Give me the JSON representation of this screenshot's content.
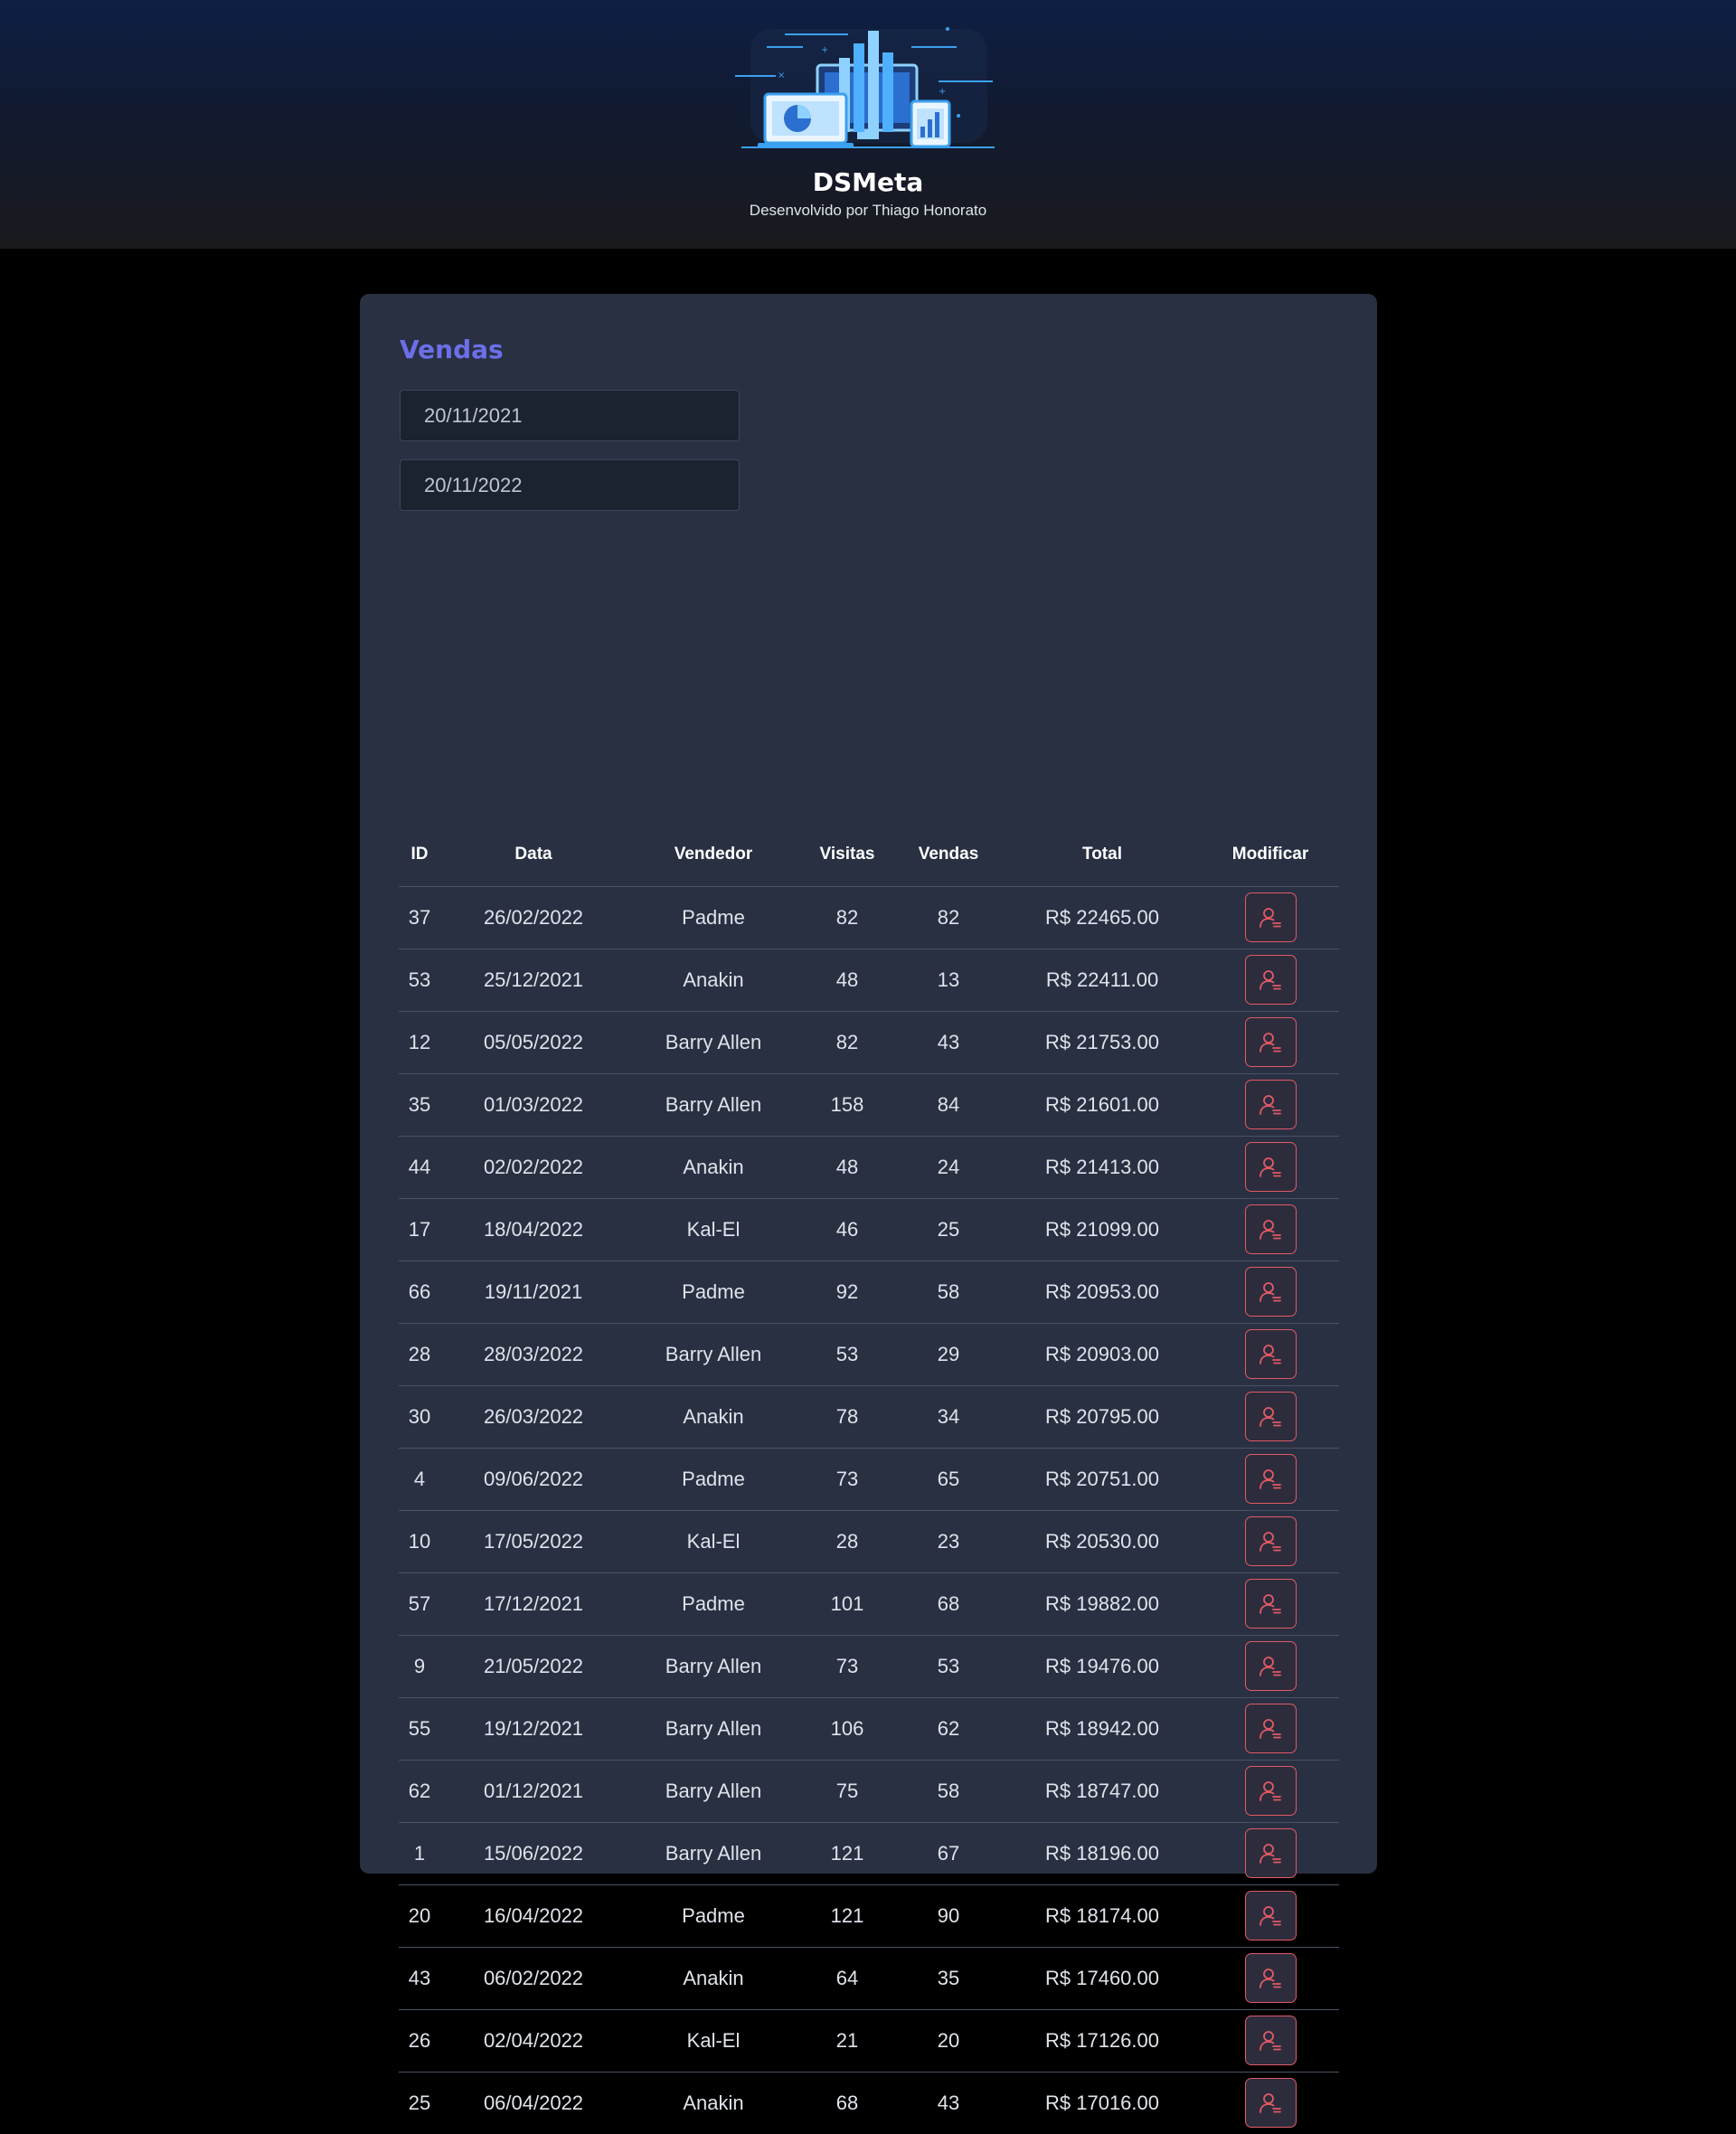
{
  "header": {
    "title": "DSMeta",
    "subtitle": "Desenvolvido por Thiago Honorato",
    "logo_icon": "dashboard-devices-illustration"
  },
  "colors": {
    "accent": "#6c6fe8",
    "card_bg": "#283042",
    "button_border": "#e15a66"
  },
  "sales": {
    "title": "Vendas",
    "min_date": "20/11/2021",
    "max_date": "20/11/2022",
    "columns": {
      "id": "ID",
      "date": "Data",
      "seller": "Vendedor",
      "visited": "Visitas",
      "deals": "Vendas",
      "amount": "Total",
      "modify": "Modificar"
    },
    "modify_icon": "user-notify-icon",
    "rows": [
      {
        "id": "37",
        "date": "26/02/2022",
        "seller": "Padme",
        "visited": "82",
        "deals": "82",
        "amount": "R$ 22465.00"
      },
      {
        "id": "53",
        "date": "25/12/2021",
        "seller": "Anakin",
        "visited": "48",
        "deals": "13",
        "amount": "R$ 22411.00"
      },
      {
        "id": "12",
        "date": "05/05/2022",
        "seller": "Barry Allen",
        "visited": "82",
        "deals": "43",
        "amount": "R$ 21753.00"
      },
      {
        "id": "35",
        "date": "01/03/2022",
        "seller": "Barry Allen",
        "visited": "158",
        "deals": "84",
        "amount": "R$ 21601.00"
      },
      {
        "id": "44",
        "date": "02/02/2022",
        "seller": "Anakin",
        "visited": "48",
        "deals": "24",
        "amount": "R$ 21413.00"
      },
      {
        "id": "17",
        "date": "18/04/2022",
        "seller": "Kal-El",
        "visited": "46",
        "deals": "25",
        "amount": "R$ 21099.00"
      },
      {
        "id": "66",
        "date": "19/11/2021",
        "seller": "Padme",
        "visited": "92",
        "deals": "58",
        "amount": "R$ 20953.00"
      },
      {
        "id": "28",
        "date": "28/03/2022",
        "seller": "Barry Allen",
        "visited": "53",
        "deals": "29",
        "amount": "R$ 20903.00"
      },
      {
        "id": "30",
        "date": "26/03/2022",
        "seller": "Anakin",
        "visited": "78",
        "deals": "34",
        "amount": "R$ 20795.00"
      },
      {
        "id": "4",
        "date": "09/06/2022",
        "seller": "Padme",
        "visited": "73",
        "deals": "65",
        "amount": "R$ 20751.00"
      },
      {
        "id": "10",
        "date": "17/05/2022",
        "seller": "Kal-El",
        "visited": "28",
        "deals": "23",
        "amount": "R$ 20530.00"
      },
      {
        "id": "57",
        "date": "17/12/2021",
        "seller": "Padme",
        "visited": "101",
        "deals": "68",
        "amount": "R$ 19882.00"
      },
      {
        "id": "9",
        "date": "21/05/2022",
        "seller": "Barry Allen",
        "visited": "73",
        "deals": "53",
        "amount": "R$ 19476.00"
      },
      {
        "id": "55",
        "date": "19/12/2021",
        "seller": "Barry Allen",
        "visited": "106",
        "deals": "62",
        "amount": "R$ 18942.00"
      },
      {
        "id": "62",
        "date": "01/12/2021",
        "seller": "Barry Allen",
        "visited": "75",
        "deals": "58",
        "amount": "R$ 18747.00"
      },
      {
        "id": "1",
        "date": "15/06/2022",
        "seller": "Barry Allen",
        "visited": "121",
        "deals": "67",
        "amount": "R$ 18196.00"
      },
      {
        "id": "20",
        "date": "16/04/2022",
        "seller": "Padme",
        "visited": "121",
        "deals": "90",
        "amount": "R$ 18174.00"
      },
      {
        "id": "43",
        "date": "06/02/2022",
        "seller": "Anakin",
        "visited": "64",
        "deals": "35",
        "amount": "R$ 17460.00"
      },
      {
        "id": "26",
        "date": "02/04/2022",
        "seller": "Kal-El",
        "visited": "21",
        "deals": "20",
        "amount": "R$ 17126.00"
      },
      {
        "id": "25",
        "date": "06/04/2022",
        "seller": "Anakin",
        "visited": "68",
        "deals": "43",
        "amount": "R$ 17016.00"
      }
    ]
  }
}
